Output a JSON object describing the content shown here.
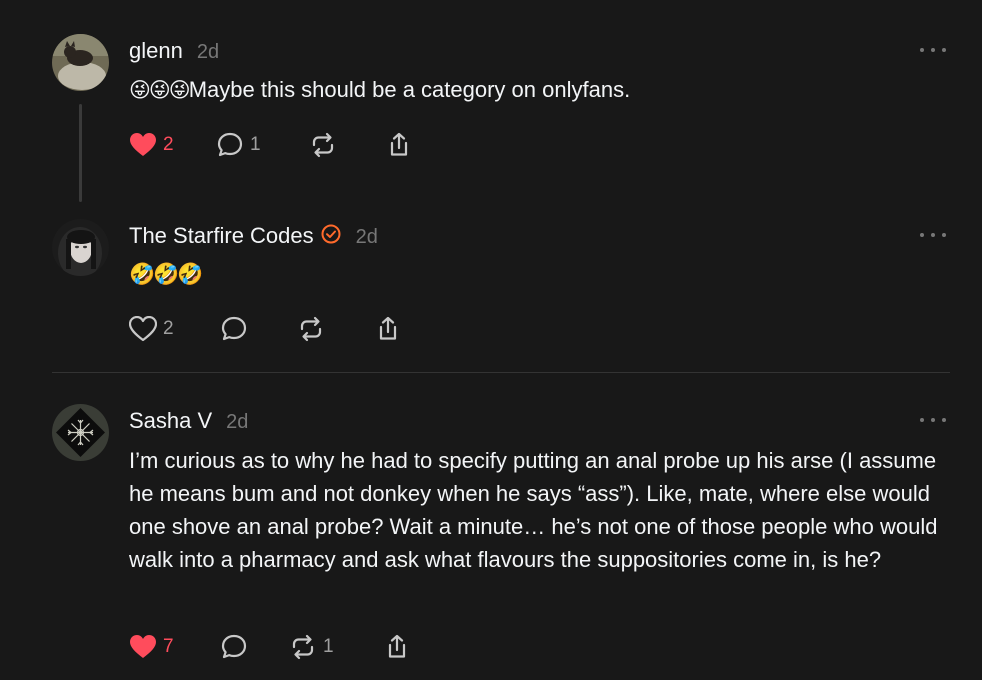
{
  "posts": [
    {
      "username": "glenn",
      "time": "2d",
      "emoji": "😜😜😜",
      "text": "Maybe this should be a category on onlyfans.",
      "likes": "2",
      "replies": "1",
      "reposts": "",
      "liked": true
    },
    {
      "username": "The Starfire Codes",
      "time": "2d",
      "emoji": "🤣🤣🤣",
      "text": "",
      "likes": "2",
      "replies": "",
      "reposts": "",
      "liked": false,
      "verified": true
    },
    {
      "username": "Sasha V",
      "time": "2d",
      "emoji": "",
      "text": "I’m curious as to why he had to specify putting an anal probe up his arse (I assume he means bum and not donkey when he says “ass”). Like, mate, where else would one shove an anal probe? Wait a minute… he’s not one of those people who would walk into a pharmacy and ask what flavours the suppositories come in, is he?",
      "likes": "7",
      "replies": "",
      "reposts": "1",
      "liked": true
    }
  ],
  "colors": {
    "background": "#181818",
    "like_red": "#ff4c5c",
    "verified_orange": "#ff6a2b",
    "muted": "#777777"
  },
  "icons": [
    "heart-icon",
    "comment-icon",
    "repost-icon",
    "share-icon",
    "more-icon",
    "verified-badge-icon"
  ]
}
